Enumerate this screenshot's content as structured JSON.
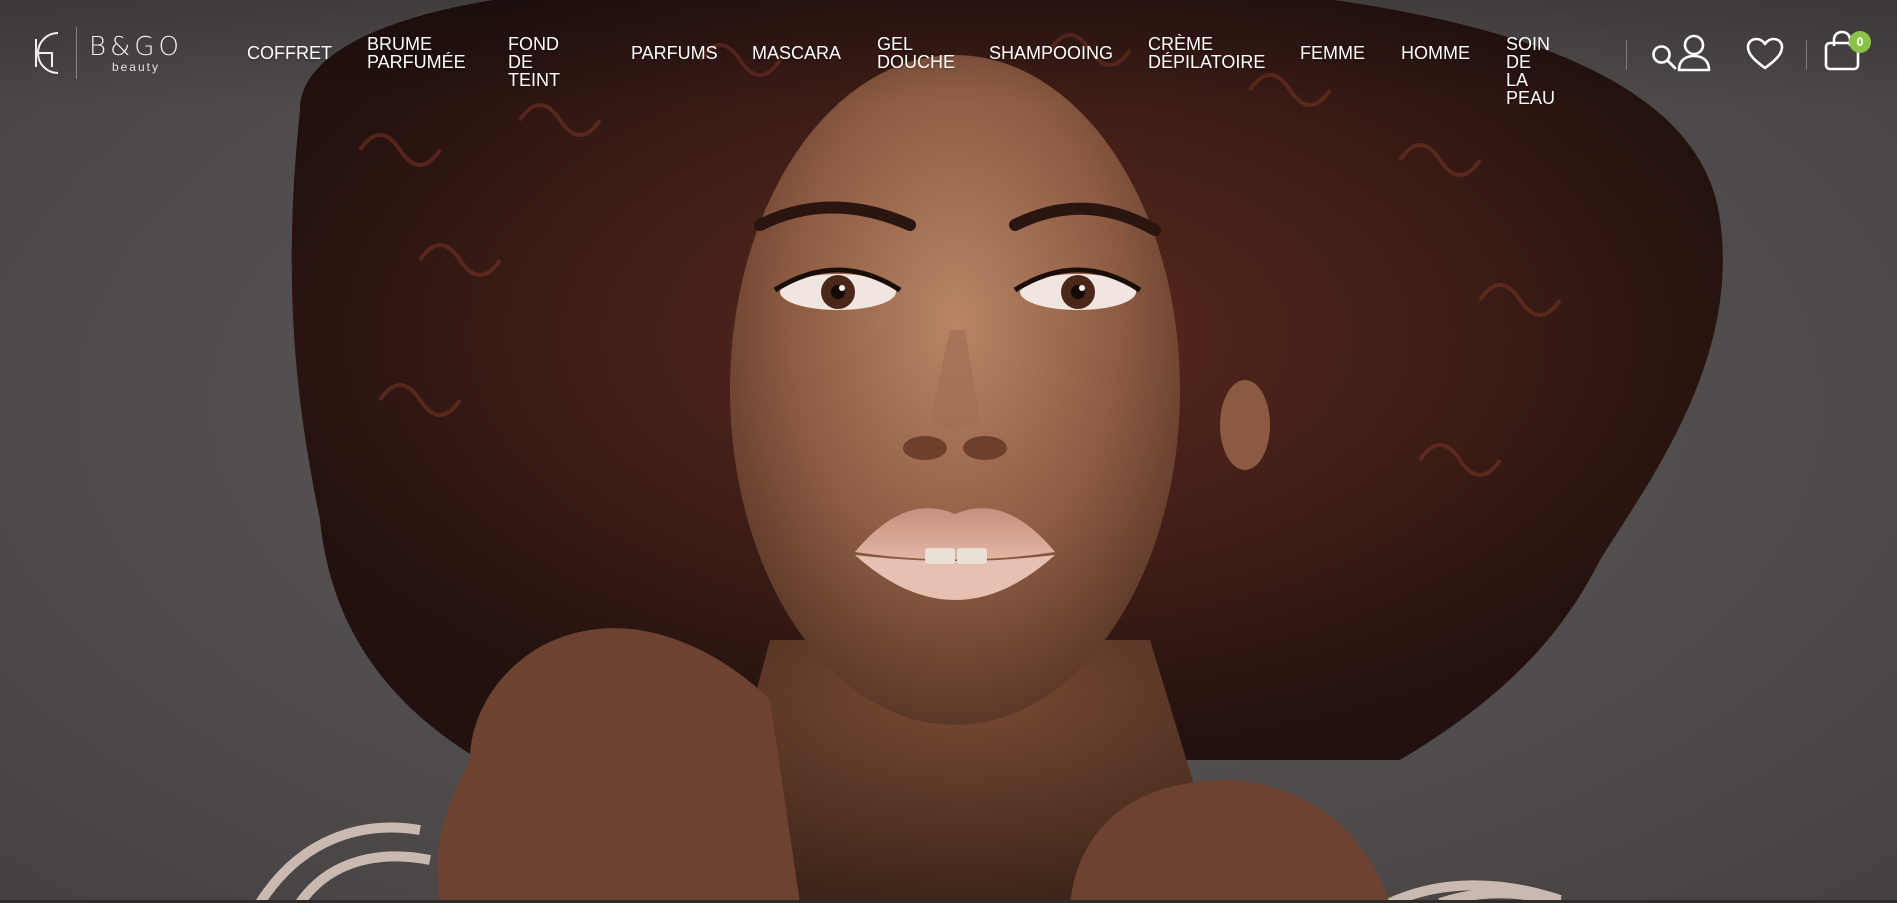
{
  "brand": {
    "name": "B&GO",
    "tagline": "beauty"
  },
  "nav": {
    "items": [
      {
        "label": "COFFRET"
      },
      {
        "label": "BRUME\nPARFUMÉE"
      },
      {
        "label": "FOND DE\nTEINT"
      },
      {
        "label": "PARFUMS"
      },
      {
        "label": "MASCARA"
      },
      {
        "label": "GEL\nDOUCHE"
      },
      {
        "label": "SHAMPOOING"
      },
      {
        "label": "CRÈME\nDÉPILATOIRE"
      },
      {
        "label": "FEMME"
      },
      {
        "label": "HOMME"
      },
      {
        "label": "SOIN DE\nLA PEAU"
      }
    ]
  },
  "header_icons": {
    "search": "search-icon",
    "account": "user-icon",
    "wishlist": "heart-icon",
    "cart": "shopping-bag-icon",
    "cart_count": "0"
  },
  "colors": {
    "nav_text": "#ffffff",
    "cart_badge": "#8bc34a",
    "background": "#555050"
  },
  "hero": {
    "image": "portrait of a woman with curly auburn hair"
  }
}
